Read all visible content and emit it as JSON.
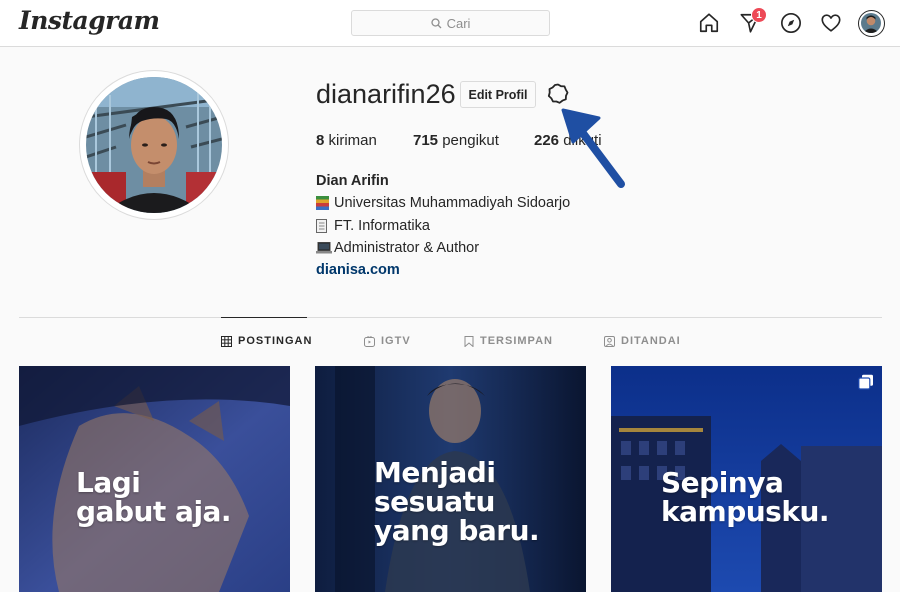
{
  "topbar": {
    "logo": "Instagram",
    "search_placeholder": "Cari",
    "notification_count": "1"
  },
  "profile": {
    "username": "dianarifin26",
    "edit_button": "Edit Profil",
    "stats": {
      "posts_count": "8",
      "posts_label": "kiriman",
      "followers_count": "715",
      "followers_label": "pengikut",
      "following_count": "226",
      "following_label": "diikuti"
    },
    "full_name": "Dian Arifin",
    "bio_lines": [
      {
        "icon": "books-emoji",
        "text": "Universitas Muhammadiyah Sidoarjo"
      },
      {
        "icon": "notebook-emoji",
        "text": "FT. Informatika"
      },
      {
        "icon": "laptop-emoji",
        "text": "Administrator & Author"
      }
    ],
    "website": "dianisa.com"
  },
  "tabs": [
    {
      "label": "POSTINGAN",
      "icon": "grid-icon",
      "active": true
    },
    {
      "label": "IGTV",
      "icon": "igtv-icon",
      "active": false
    },
    {
      "label": "TERSIMPAN",
      "icon": "bookmark-icon",
      "active": false
    },
    {
      "label": "DITANDAI",
      "icon": "tagged-icon",
      "active": false
    }
  ],
  "posts": [
    {
      "caption_lines": [
        "Lagi",
        "gabut aja."
      ]
    },
    {
      "caption_lines": [
        "Menjadi",
        "sesuatu",
        "yang baru."
      ]
    },
    {
      "caption_lines": [
        "Sepinya",
        "kampusku."
      ],
      "multi": true
    }
  ],
  "colors": {
    "background": "#fafafa",
    "border": "#dbdbdb",
    "text": "#262626",
    "muted": "#8e8e8e",
    "link": "#00376b",
    "badge": "#ed4956",
    "annotation_arrow": "#1f4fa3"
  }
}
